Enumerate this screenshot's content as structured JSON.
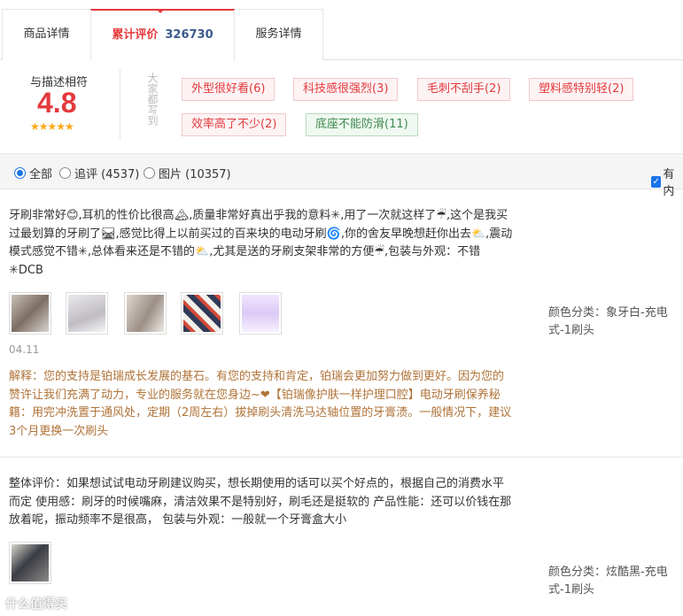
{
  "tabs": {
    "detail": "商品详情",
    "review": "累计评价",
    "review_count": "326730",
    "service": "服务详情"
  },
  "summary": {
    "label": "与描述相符",
    "score": "4.8",
    "stars": "★★★★★",
    "everyone_says": "大家都写到",
    "tags": [
      {
        "text": "外型很好看(6)"
      },
      {
        "text": "科技感很强烈(3)"
      },
      {
        "text": "毛刺不刮手(2)"
      },
      {
        "text": "塑料感特别轻(2)"
      },
      {
        "text": "效率高了不少(2)"
      },
      {
        "text": "底座不能防滑(11)"
      }
    ]
  },
  "filter": {
    "all": "全部",
    "append": "追评 (4537)",
    "pictures": "图片 (10357)",
    "has_content": "有内"
  },
  "reviews": [
    {
      "text": "牙刷非常好😊,耳机的性价比很高🏔,质量非常好真出乎我的意料✳,用了一次就这样了☔,这个是我买过最划算的牙刷了🛤,感觉比得上以前买过的百来块的电动牙刷🌀,你的舍友早晚想赶你出去⛅,震动模式感觉不错✳,总体看来还是不错的⛅,尤其是送的牙刷支架非常的方便☔,包装与外观：不错✳DCB",
      "date": "04.11",
      "reply": "解释：您的支持是铂瑞成长发展的基石。有您的支持和肯定，铂瑞会更加努力做到更好。因为您的赞许让我们充满了动力，专业的服务就在您身边~❤【铂瑞像护肤一样护理口腔】电动牙刷保养秘籍：用完冲洗置于通风处，定期（2周左右）拔掉刷头清洗马达轴位置的牙膏渍。一般情况下，建议3个月更换一次刷头",
      "spec": "颜色分类：象牙白-充电式-1刷头"
    },
    {
      "text": "整体评价：如果想试试电动牙刷建议购买，想长期使用的话可以买个好点的，根据自己的消费水平而定 使用感：刷牙的时候嘴麻，清洁效果不是特别好，刷毛还是挺软的 产品性能：还可以价钱在那放着呢，振动频率不是很高， 包装与外观：一般就一个牙膏盒大小",
      "spec": "颜色分类：炫酷黑-充电式-1刷头"
    }
  ],
  "watermark": "什么值得买"
}
